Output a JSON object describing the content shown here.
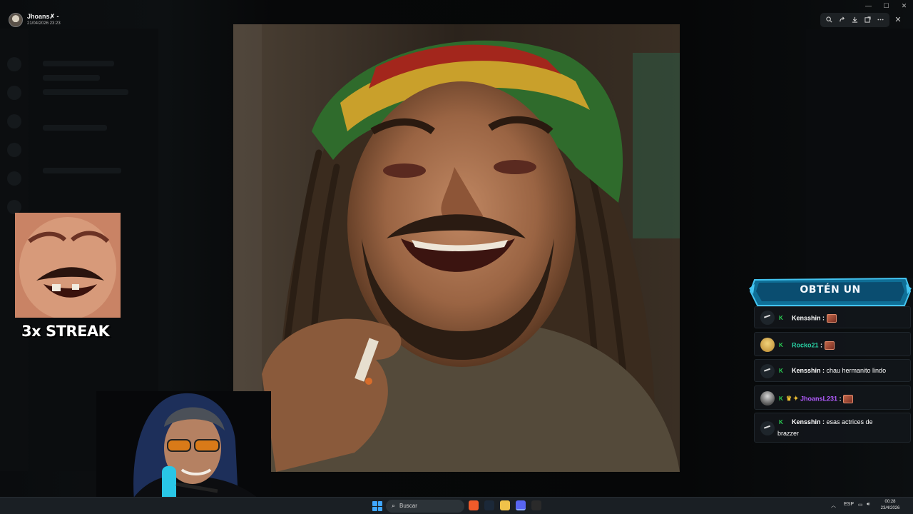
{
  "window": {
    "title": "",
    "controls": [
      "—",
      "☐",
      "✕"
    ]
  },
  "viewer": {
    "user_name": "Jhoans✗ -",
    "date": "21/04/2026 23:23",
    "tools": [
      "zoom-icon",
      "share-icon",
      "download-icon",
      "open-icon",
      "more-icon"
    ],
    "close_icon": "✕"
  },
  "overlay": {
    "streak_text": "3x STREAK",
    "banner_text": "OBTÉN UN"
  },
  "chat": [
    {
      "badge": "K",
      "name": "Kensshin",
      "sep": " : ",
      "msg": "",
      "emote": true,
      "name_color": "#ffffff",
      "avatar": "dark"
    },
    {
      "badge": "K",
      "name": "Rocko21",
      "sep": " : ",
      "msg": "",
      "emote": true,
      "name_color": "#28d0a3",
      "avatar": "gold"
    },
    {
      "badge": "K",
      "name": "Kensshin",
      "sep": " : ",
      "msg": "chau hermanito lindo",
      "emote": false,
      "name_color": "#ffffff",
      "avatar": "dark"
    },
    {
      "badge": "K",
      "name": "JhoansL231",
      "sep": " : ",
      "msg": "",
      "emote": true,
      "name_color": "#b35cff",
      "avatar": "person"
    },
    {
      "badge": "K",
      "name": "Kensshin",
      "sep": " : ",
      "msg": "esas actrices de",
      "msg2": "brazzer",
      "emote": false,
      "name_color": "#ffffff",
      "avatar": "dark"
    }
  ],
  "taskbar": {
    "search_placeholder": "Buscar",
    "lang": "ESP",
    "time": "00:28",
    "date": "23/4/2026"
  },
  "colors": {
    "accent_blue": "#3fa6ff",
    "banner_blue": "#1aa3d6",
    "badge_green": "#2bd154"
  }
}
